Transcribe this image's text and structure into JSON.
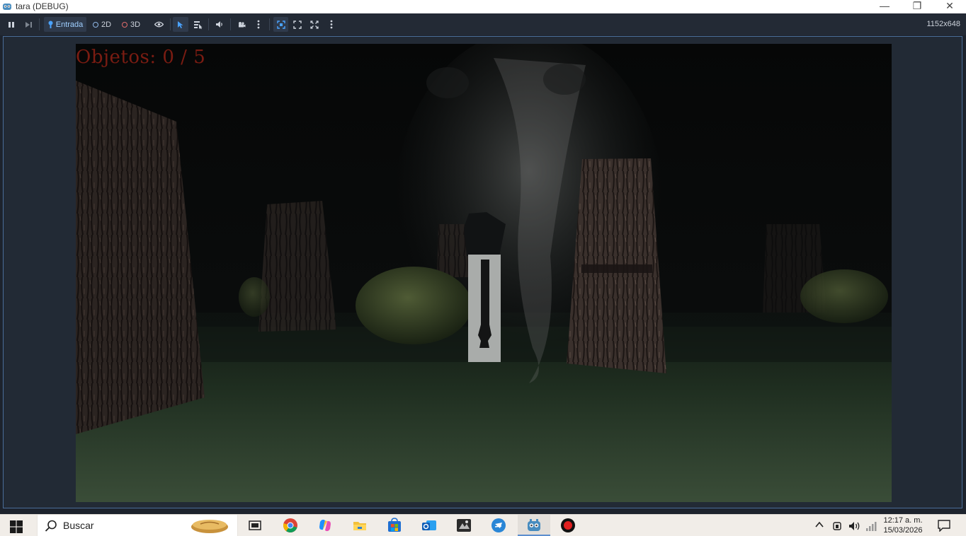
{
  "window": {
    "title": "tara (DEBUG)",
    "minimize_glyph": "—",
    "maximize_glyph": "❐",
    "close_glyph": "✕"
  },
  "toolbar": {
    "input_label": "Entrada",
    "mode_2d_label": "2D",
    "mode_3d_label": "3D",
    "resolution": "1152x648"
  },
  "game": {
    "hud_objects": "Objetos: 0 / 5"
  },
  "taskbar": {
    "search_placeholder": "Buscar",
    "clock_time": "12:17 a. m.",
    "clock_date": "15/03/2026"
  },
  "colors": {
    "hud_text": "#7a1c12",
    "toolbar_bg": "#232a35",
    "frame_border": "#4a6d99",
    "accent_blue": "#4aa3ff"
  }
}
